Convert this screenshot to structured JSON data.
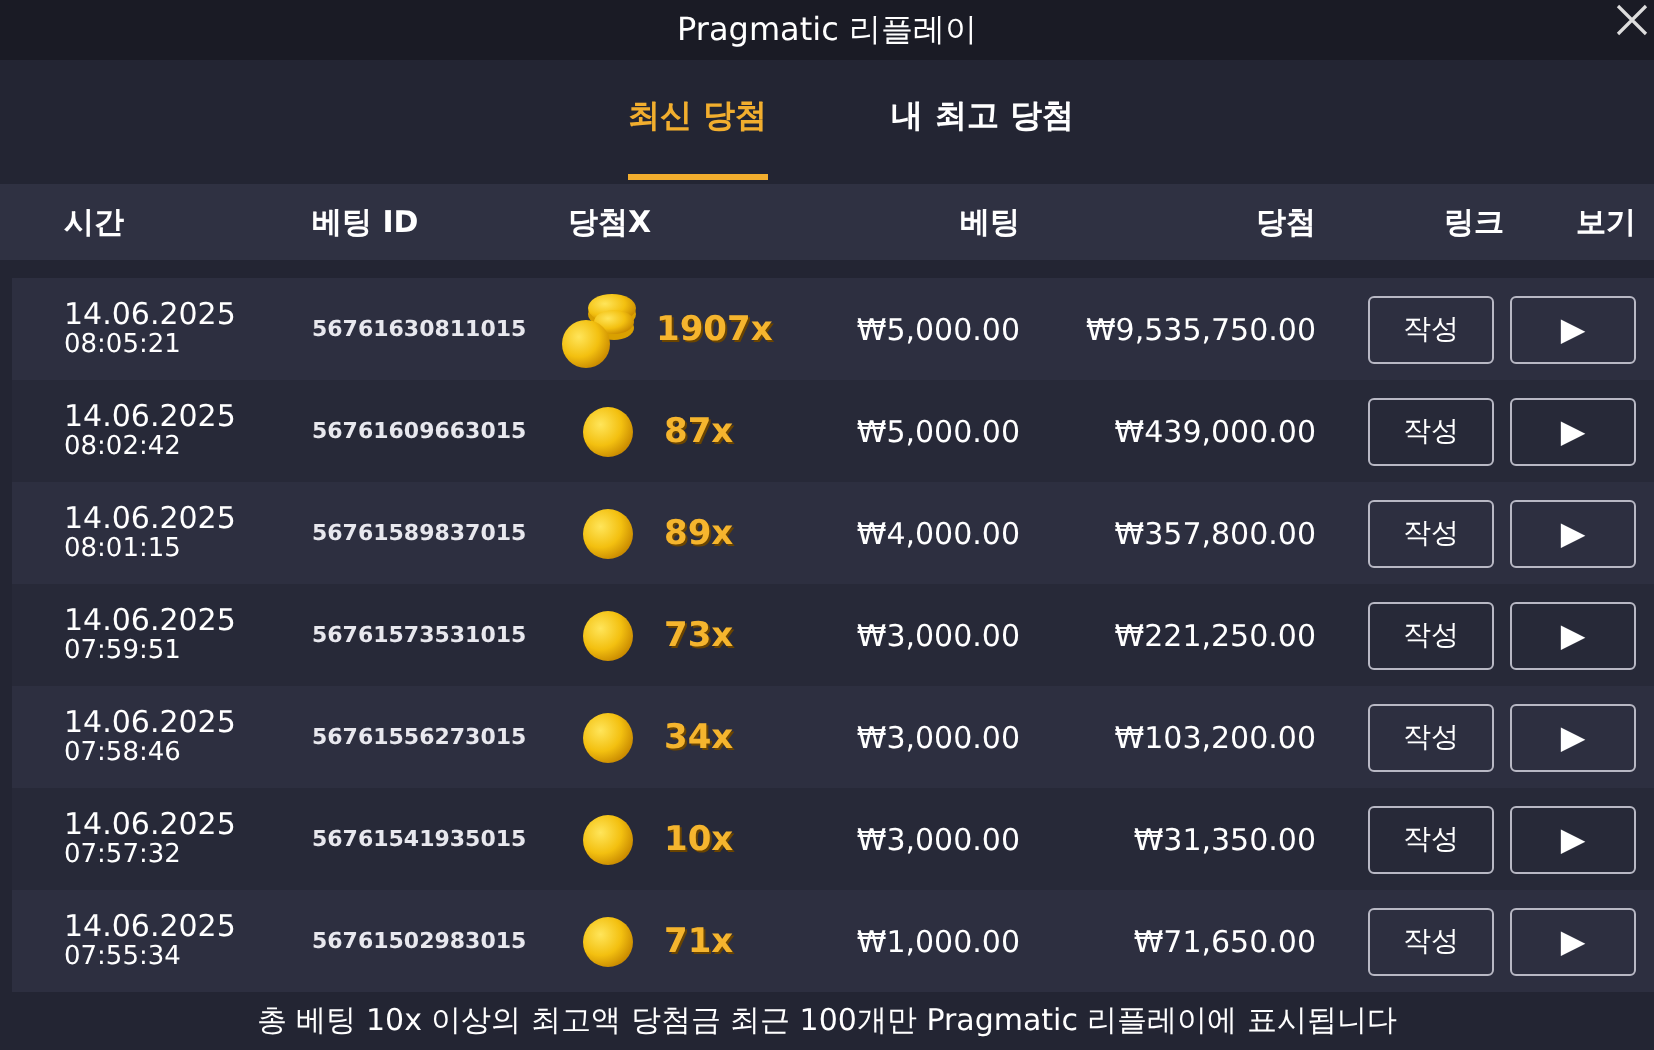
{
  "window": {
    "title": "Pragmatic 리플레이"
  },
  "tabs": [
    {
      "label": "최신 당첨",
      "selected": true
    },
    {
      "label": "내 최고 당첨",
      "selected": false
    }
  ],
  "table": {
    "columns": [
      "시간",
      "베팅 ID",
      "당첨X",
      "베팅",
      "당첨",
      "링크",
      "보기"
    ],
    "rows": [
      {
        "date": "14.06.2025",
        "time": "08:05:21",
        "bet_id": "56761630811015",
        "kind": "stack",
        "multiplier": "1907x",
        "bet": "₩5,000.00",
        "win": "₩9,535,750.00",
        "link_button": "작성",
        "play_button": "▶"
      },
      {
        "date": "14.06.2025",
        "time": "08:02:42",
        "bet_id": "56761609663015",
        "kind": "single",
        "multiplier": "87x",
        "bet": "₩5,000.00",
        "win": "₩439,000.00",
        "link_button": "작성",
        "play_button": "▶"
      },
      {
        "date": "14.06.2025",
        "time": "08:01:15",
        "bet_id": "56761589837015",
        "kind": "single",
        "multiplier": "89x",
        "bet": "₩4,000.00",
        "win": "₩357,800.00",
        "link_button": "작성",
        "play_button": "▶"
      },
      {
        "date": "14.06.2025",
        "time": "07:59:51",
        "bet_id": "56761573531015",
        "kind": "single",
        "multiplier": "73x",
        "bet": "₩3,000.00",
        "win": "₩221,250.00",
        "link_button": "작성",
        "play_button": "▶"
      },
      {
        "date": "14.06.2025",
        "time": "07:58:46",
        "bet_id": "56761556273015",
        "kind": "single",
        "multiplier": "34x",
        "bet": "₩3,000.00",
        "win": "₩103,200.00",
        "link_button": "작성",
        "play_button": "▶"
      },
      {
        "date": "14.06.2025",
        "time": "07:57:32",
        "bet_id": "56761541935015",
        "kind": "single",
        "multiplier": "10x",
        "bet": "₩3,000.00",
        "win": "₩31,350.00",
        "link_button": "작성",
        "play_button": "▶"
      },
      {
        "date": "14.06.2025",
        "time": "07:55:34",
        "bet_id": "56761502983015",
        "kind": "single",
        "multiplier": "71x",
        "bet": "₩1,000.00",
        "win": "₩71,650.00",
        "link_button": "작성",
        "play_button": "▶"
      }
    ]
  },
  "footer": "총 베팅 10x 이상의 최고액 당첨금 최근 100개만 Pragmatic 리플레이에 표시됩니다"
}
